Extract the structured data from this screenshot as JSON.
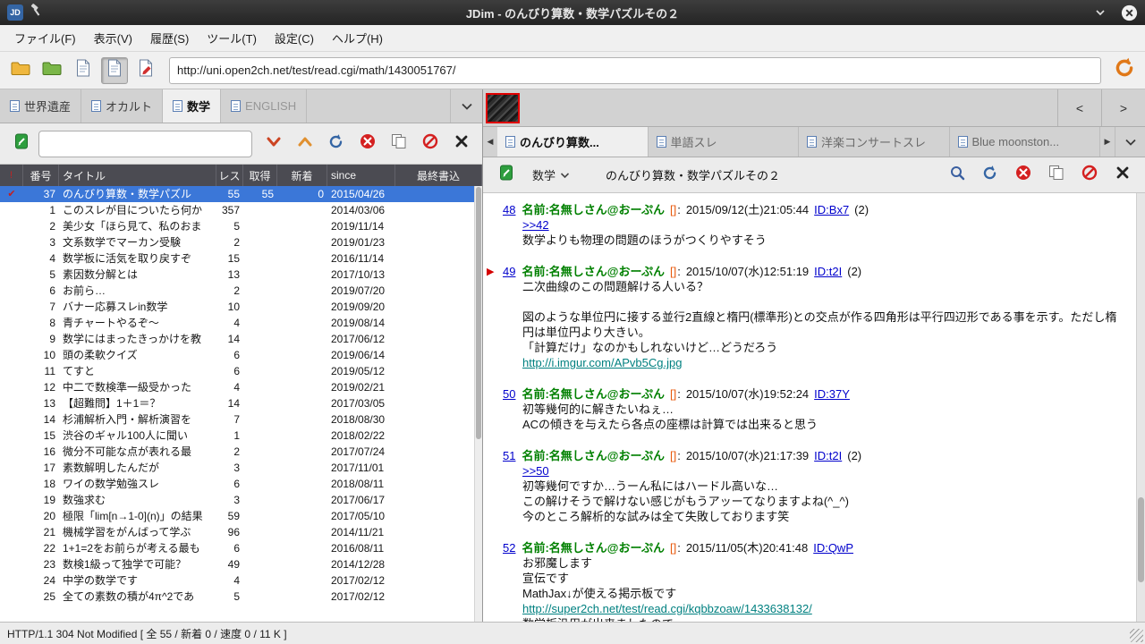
{
  "titlebar": {
    "logo": "JD",
    "title": "JDim - のんびり算数・数学パズルその２"
  },
  "menubar": {
    "items": [
      "ファイル(F)",
      "表示(V)",
      "履歴(S)",
      "ツール(T)",
      "設定(C)",
      "ヘルプ(H)"
    ]
  },
  "urlbar": {
    "value": "http://uni.open2ch.net/test/read.cgi/math/1430051767/"
  },
  "board_tabs": [
    {
      "label": "世界遺産",
      "active": false,
      "dimmed": false
    },
    {
      "label": "オカルト",
      "active": false,
      "dimmed": false
    },
    {
      "label": "数学",
      "active": true,
      "dimmed": false
    },
    {
      "label": "ENGLISH",
      "active": false,
      "dimmed": true
    }
  ],
  "image_bar": {
    "prev_label": "<",
    "next_label": ">"
  },
  "board_panel": {
    "search_value": "",
    "header": {
      "mark": "!",
      "num": "番号",
      "title": "タイトル",
      "res": "レス",
      "get": "取得",
      "new": "新着",
      "since": "since",
      "last": "最終書込"
    },
    "rows": [
      {
        "mark": "✔",
        "num": "37",
        "title": "のんびり算数・数学パズル",
        "res": "55",
        "get": "55",
        "new": "0",
        "since": "2015/04/26",
        "last": "",
        "selected": true
      },
      {
        "mark": "",
        "num": "1",
        "title": "このスレが目についたら何か",
        "res": "357",
        "get": "",
        "new": "",
        "since": "2014/03/06",
        "last": "",
        "selected": false
      },
      {
        "mark": "",
        "num": "2",
        "title": "美少女「ほら見て、私のおま",
        "res": "5",
        "get": "",
        "new": "",
        "since": "2019/11/14",
        "last": "",
        "selected": false
      },
      {
        "mark": "",
        "num": "3",
        "title": "文系数学でマーカン受験",
        "res": "2",
        "get": "",
        "new": "",
        "since": "2019/01/23",
        "last": "",
        "selected": false
      },
      {
        "mark": "",
        "num": "4",
        "title": "数学板に活気を取り戻すぞ",
        "res": "15",
        "get": "",
        "new": "",
        "since": "2016/11/14",
        "last": "",
        "selected": false
      },
      {
        "mark": "",
        "num": "5",
        "title": "素因数分解とは",
        "res": "13",
        "get": "",
        "new": "",
        "since": "2017/10/13",
        "last": "",
        "selected": false
      },
      {
        "mark": "",
        "num": "6",
        "title": "お前ら…",
        "res": "2",
        "get": "",
        "new": "",
        "since": "2019/07/20",
        "last": "",
        "selected": false
      },
      {
        "mark": "",
        "num": "7",
        "title": "バナー応募スレin数学",
        "res": "10",
        "get": "",
        "new": "",
        "since": "2019/09/20",
        "last": "",
        "selected": false
      },
      {
        "mark": "",
        "num": "8",
        "title": "青チャートやるぞ〜",
        "res": "4",
        "get": "",
        "new": "",
        "since": "2019/08/14",
        "last": "",
        "selected": false
      },
      {
        "mark": "",
        "num": "9",
        "title": "数学にはまったきっかけを教",
        "res": "14",
        "get": "",
        "new": "",
        "since": "2017/06/12",
        "last": "",
        "selected": false
      },
      {
        "mark": "",
        "num": "10",
        "title": "頭の柔軟クイズ",
        "res": "6",
        "get": "",
        "new": "",
        "since": "2019/06/14",
        "last": "",
        "selected": false
      },
      {
        "mark": "",
        "num": "11",
        "title": "てすと",
        "res": "6",
        "get": "",
        "new": "",
        "since": "2019/05/12",
        "last": "",
        "selected": false
      },
      {
        "mark": "",
        "num": "12",
        "title": "中二で数検準一級受かった",
        "res": "4",
        "get": "",
        "new": "",
        "since": "2019/02/21",
        "last": "",
        "selected": false
      },
      {
        "mark": "",
        "num": "13",
        "title": "【超難問】1＋1＝？",
        "res": "14",
        "get": "",
        "new": "",
        "since": "2017/03/05",
        "last": "",
        "selected": false
      },
      {
        "mark": "",
        "num": "14",
        "title": "杉浦解析入門・解析演習を",
        "res": "7",
        "get": "",
        "new": "",
        "since": "2018/08/30",
        "last": "",
        "selected": false
      },
      {
        "mark": "",
        "num": "15",
        "title": "渋谷のギャル100人に聞い",
        "res": "1",
        "get": "",
        "new": "",
        "since": "2018/02/22",
        "last": "",
        "selected": false
      },
      {
        "mark": "",
        "num": "16",
        "title": "微分不可能な点が表れる最",
        "res": "2",
        "get": "",
        "new": "",
        "since": "2017/07/24",
        "last": "",
        "selected": false
      },
      {
        "mark": "",
        "num": "17",
        "title": "素数解明したんだが",
        "res": "3",
        "get": "",
        "new": "",
        "since": "2017/11/01",
        "last": "",
        "selected": false
      },
      {
        "mark": "",
        "num": "18",
        "title": "ワイの数学勉強スレ",
        "res": "6",
        "get": "",
        "new": "",
        "since": "2018/08/11",
        "last": "",
        "selected": false
      },
      {
        "mark": "",
        "num": "19",
        "title": "数強求む",
        "res": "3",
        "get": "",
        "new": "",
        "since": "2017/06/17",
        "last": "",
        "selected": false
      },
      {
        "mark": "",
        "num": "20",
        "title": "極限「lim[n→1-0](n)」の結果",
        "res": "59",
        "get": "",
        "new": "",
        "since": "2017/05/10",
        "last": "",
        "selected": false
      },
      {
        "mark": "",
        "num": "21",
        "title": "機械学習をがんばって学ぶ",
        "res": "96",
        "get": "",
        "new": "",
        "since": "2014/11/21",
        "last": "",
        "selected": false
      },
      {
        "mark": "",
        "num": "22",
        "title": "1+1=2をお前らが考える最も",
        "res": "6",
        "get": "",
        "new": "",
        "since": "2016/08/11",
        "last": "",
        "selected": false
      },
      {
        "mark": "",
        "num": "23",
        "title": "数検1級って独学で可能？",
        "res": "49",
        "get": "",
        "new": "",
        "since": "2014/12/28",
        "last": "",
        "selected": false
      },
      {
        "mark": "",
        "num": "24",
        "title": "中学の数学です",
        "res": "4",
        "get": "",
        "new": "",
        "since": "2017/02/12",
        "last": "",
        "selected": false
      },
      {
        "mark": "",
        "num": "25",
        "title": "全ての素数の積が4π^2であ",
        "res": "5",
        "get": "",
        "new": "",
        "since": "2017/02/12",
        "last": "",
        "selected": false
      }
    ]
  },
  "thread_tabs": [
    {
      "label": "のんびり算数...",
      "active": true
    },
    {
      "label": "単語スレ",
      "active": false
    },
    {
      "label": "洋楽コンサートスレ",
      "active": false
    },
    {
      "label": "Blue moonston...",
      "active": false
    }
  ],
  "thread_panel": {
    "board_name": "数学",
    "title": "のんびり算数・数学パズルその２",
    "posts": [
      {
        "num": "48",
        "marked": false,
        "name_label": "名前:",
        "name": "名無しさん@おーぷん",
        "mail": "[]",
        "date": "2015/09/12(土)21:05:44",
        "id": "ID:Bx7",
        "count": "(2)",
        "lines": [
          {
            "type": "anchor",
            "text": ">>42"
          },
          {
            "type": "text",
            "text": "数学よりも物理の問題のほうがつくりやすそう"
          }
        ]
      },
      {
        "num": "49",
        "marked": true,
        "name_label": "名前:",
        "name": "名無しさん@おーぷん",
        "mail": "[]",
        "date": "2015/10/07(水)12:51:19",
        "id": "ID:t2I",
        "count": "(2)",
        "lines": [
          {
            "type": "text",
            "text": "二次曲線のこの問題解ける人いる？"
          },
          {
            "type": "text",
            "text": ""
          },
          {
            "type": "text",
            "text": "図のような単位円に接する並行2直線と楕円(標準形)との交点が作る四角形は平行四辺形である事を示す。ただし楕円は単位円より大きい。"
          },
          {
            "type": "text",
            "text": "「計算だけ」なのかもしれないけど…どうだろう"
          },
          {
            "type": "link",
            "text": "http://i.imgur.com/APvb5Cg.jpg"
          }
        ]
      },
      {
        "num": "50",
        "marked": false,
        "name_label": "名前:",
        "name": "名無しさん@おーぷん",
        "mail": "[]",
        "date": "2015/10/07(水)19:52:24",
        "id": "ID:37Y",
        "count": "",
        "lines": [
          {
            "type": "text",
            "text": "初等幾何的に解きたいねぇ…"
          },
          {
            "type": "text",
            "text": "ACの傾きを与えたら各点の座標は計算では出来ると思う"
          }
        ]
      },
      {
        "num": "51",
        "marked": false,
        "name_label": "名前:",
        "name": "名無しさん@おーぷん",
        "mail": "[]",
        "date": "2015/10/07(水)21:17:39",
        "id": "ID:t2I",
        "count": "(2)",
        "lines": [
          {
            "type": "anchor",
            "text": ">>50"
          },
          {
            "type": "text",
            "text": "初等幾何ですか…うーん私にはハードル高いな…"
          },
          {
            "type": "text",
            "text": "この解けそうで解けない感じがもうアッーてなりますよね(^_^)"
          },
          {
            "type": "text",
            "text": "今のところ解析的な試みは全て失敗しております笑"
          }
        ]
      },
      {
        "num": "52",
        "marked": false,
        "name_label": "名前:",
        "name": "名無しさん@おーぷん",
        "mail": "[]",
        "date": "2015/11/05(木)20:41:48",
        "id": "ID:QwP",
        "count": "",
        "lines": [
          {
            "type": "text",
            "text": "お邪魔します"
          },
          {
            "type": "text",
            "text": "宣伝です"
          },
          {
            "type": "text",
            "text": "MathJax↓が使える掲示板です"
          },
          {
            "type": "link",
            "text": "http://super2ch.net/test/read.cgi/kqbbzoaw/1433638132/"
          },
          {
            "type": "text",
            "text": "数学板汎用が出来ましたので"
          }
        ]
      }
    ]
  },
  "statusbar": {
    "text": "HTTP/1.1 304 Not Modified [ 全 55 / 新着 0 / 速度 0 / 11 K ]"
  },
  "colors": {
    "selection_blue": "#3b77d8",
    "name_green": "#008000",
    "anchor_blue": "#0000cc",
    "link_teal": "#008080",
    "mail_orange": "#e8590c",
    "marker_red": "#d40000",
    "check_red": "#c42222",
    "reload_orange": "#e07818"
  }
}
